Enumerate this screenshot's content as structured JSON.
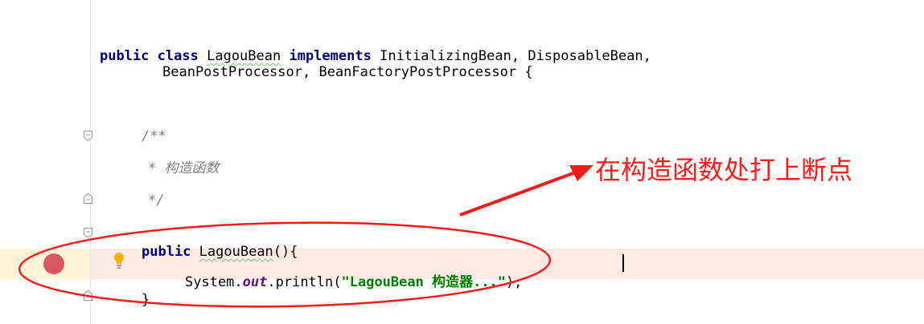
{
  "code": {
    "line1": {
      "kw_public": "public",
      "kw_class": "class",
      "class_name": "LagouBean",
      "kw_implements": "implements",
      "interfaces": "InitializingBean, DisposableBean,"
    },
    "line2": {
      "text": "BeanPostProcessor, BeanFactoryPostProcessor {"
    },
    "comment_open": "/**",
    "comment_body": "* 构造函数",
    "comment_close": "*/",
    "ctor": {
      "kw_public": "public",
      "name": "LagouBean",
      "rest": "(){"
    },
    "println": {
      "prefix": "System.",
      "field": "out",
      "method": ".println(",
      "string": "\"LagouBean 构造器...\"",
      "suffix": ");"
    },
    "closing_brace": "}"
  },
  "annotation": {
    "text": "在构造函数处打上断点",
    "color": "#ff1a1a"
  },
  "colors": {
    "keyword": "#000080",
    "comment": "#808080",
    "string": "#008000",
    "field": "#660e7a",
    "breakpoint": "#db5860",
    "breakpoint_line_bg": "#faeae6"
  },
  "icons": [
    "breakpoint-icon",
    "fold-icon",
    "lightbulb-icon"
  ]
}
